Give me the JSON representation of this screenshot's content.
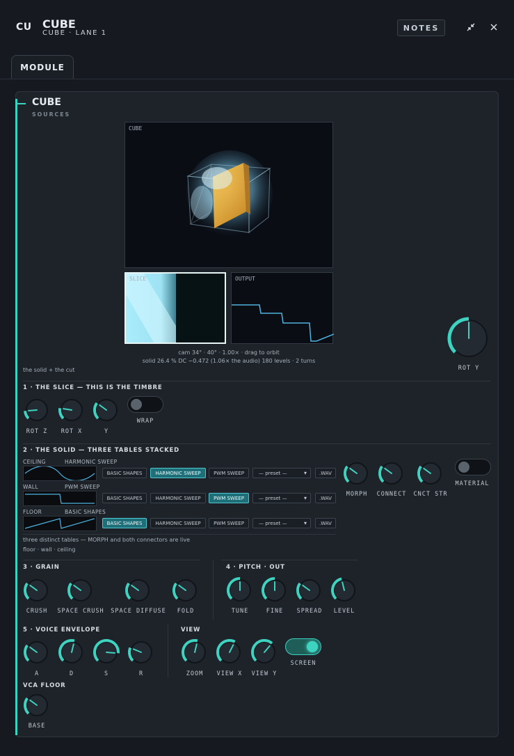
{
  "header": {
    "abbr": "CU",
    "title": "CUBE",
    "subtitle": "CUBE · LANE 1",
    "notes_label": "NOTES",
    "icons": [
      "collapse-icon",
      "close-icon"
    ]
  },
  "tabs": [
    {
      "label": "MODULE",
      "active": true
    }
  ],
  "section": {
    "title": "CUBE",
    "subtitle": "SOURCES"
  },
  "views": {
    "cube_label": "CUBE",
    "slice_label": "SLICE",
    "output_label": "OUTPUT",
    "caption_line1": "cam 34° · 40° · 1.00× · drag to orbit",
    "caption_line2": "solid 26.4 % DC −0.472 (1.06× the audio) 180 levels · 2 turns",
    "left_note": "the solid + the cut"
  },
  "rot_y": {
    "label": "ROT Y",
    "value": 0.5
  },
  "slice_group": {
    "title": "1 · THE SLICE — THIS IS THE TIMBRE",
    "knobs": [
      {
        "label": "ROT Z",
        "value": 0.15
      },
      {
        "label": "ROT X",
        "value": 0.2
      },
      {
        "label": "Y",
        "value": 0.3
      }
    ],
    "wrap": {
      "label": "WRAP",
      "on": false
    }
  },
  "solid_group": {
    "title": "2 · THE SOLID — THREE TABLES STACKED",
    "tables": [
      {
        "name": "CEILING",
        "source": "HARMONIC SWEEP",
        "active": 1
      },
      {
        "name": "WALL",
        "source": "PWM SWEEP",
        "active": 2
      },
      {
        "name": "FLOOR",
        "source": "BASIC SHAPES",
        "active": 0
      }
    ],
    "chips": [
      "BASIC SHAPES",
      "HARMONIC SWEEP",
      "PWM SWEEP"
    ],
    "preset_label": "— preset —",
    "wav_label": ".WAV",
    "note1": "three distinct tables — MORPH and both connectors are live",
    "note2": "floor · wall · ceiling",
    "knobs": [
      {
        "label": "MORPH",
        "value": 0.3
      },
      {
        "label": "CONNECT",
        "value": 0.3
      },
      {
        "label": "CNCT STR",
        "value": 0.3
      }
    ],
    "material": {
      "label": "MATERIAL",
      "on": false
    }
  },
  "grain_group": {
    "title": "3 · GRAIN",
    "knobs": [
      {
        "label": "CRUSH",
        "value": 0.3
      },
      {
        "label": "SPACE CRUSH",
        "value": 0.3
      },
      {
        "label": "SPACE DIFFUSE",
        "value": 0.3
      },
      {
        "label": "FOLD",
        "value": 0.3
      }
    ]
  },
  "pitch_group": {
    "title": "4 · PITCH · OUT",
    "knobs": [
      {
        "label": "TUNE",
        "value": 0.5
      },
      {
        "label": "FINE",
        "value": 0.5
      },
      {
        "label": "SPREAD",
        "value": 0.3
      },
      {
        "label": "LEVEL",
        "value": 0.45
      }
    ]
  },
  "env_group": {
    "title": "5 · VOICE ENVELOPE",
    "knobs": [
      {
        "label": "A",
        "value": 0.3
      },
      {
        "label": "D",
        "value": 0.55
      },
      {
        "label": "S",
        "value": 0.85
      },
      {
        "label": "R",
        "value": 0.25
      }
    ]
  },
  "view_group": {
    "title": "VIEW",
    "knobs": [
      {
        "label": "ZOOM",
        "value": 0.55
      },
      {
        "label": "VIEW X",
        "value": 0.6
      },
      {
        "label": "VIEW Y",
        "value": 0.65
      }
    ],
    "screen": {
      "label": "SCREEN",
      "on": true
    }
  },
  "vca_group": {
    "title": "VCA FLOOR",
    "knobs": [
      {
        "label": "BASE",
        "value": 0.3
      }
    ]
  },
  "colors": {
    "accent": "#3ed2c0",
    "background": "#161a20",
    "panel": "#1e232a",
    "chip_active": "#1e6f78"
  }
}
